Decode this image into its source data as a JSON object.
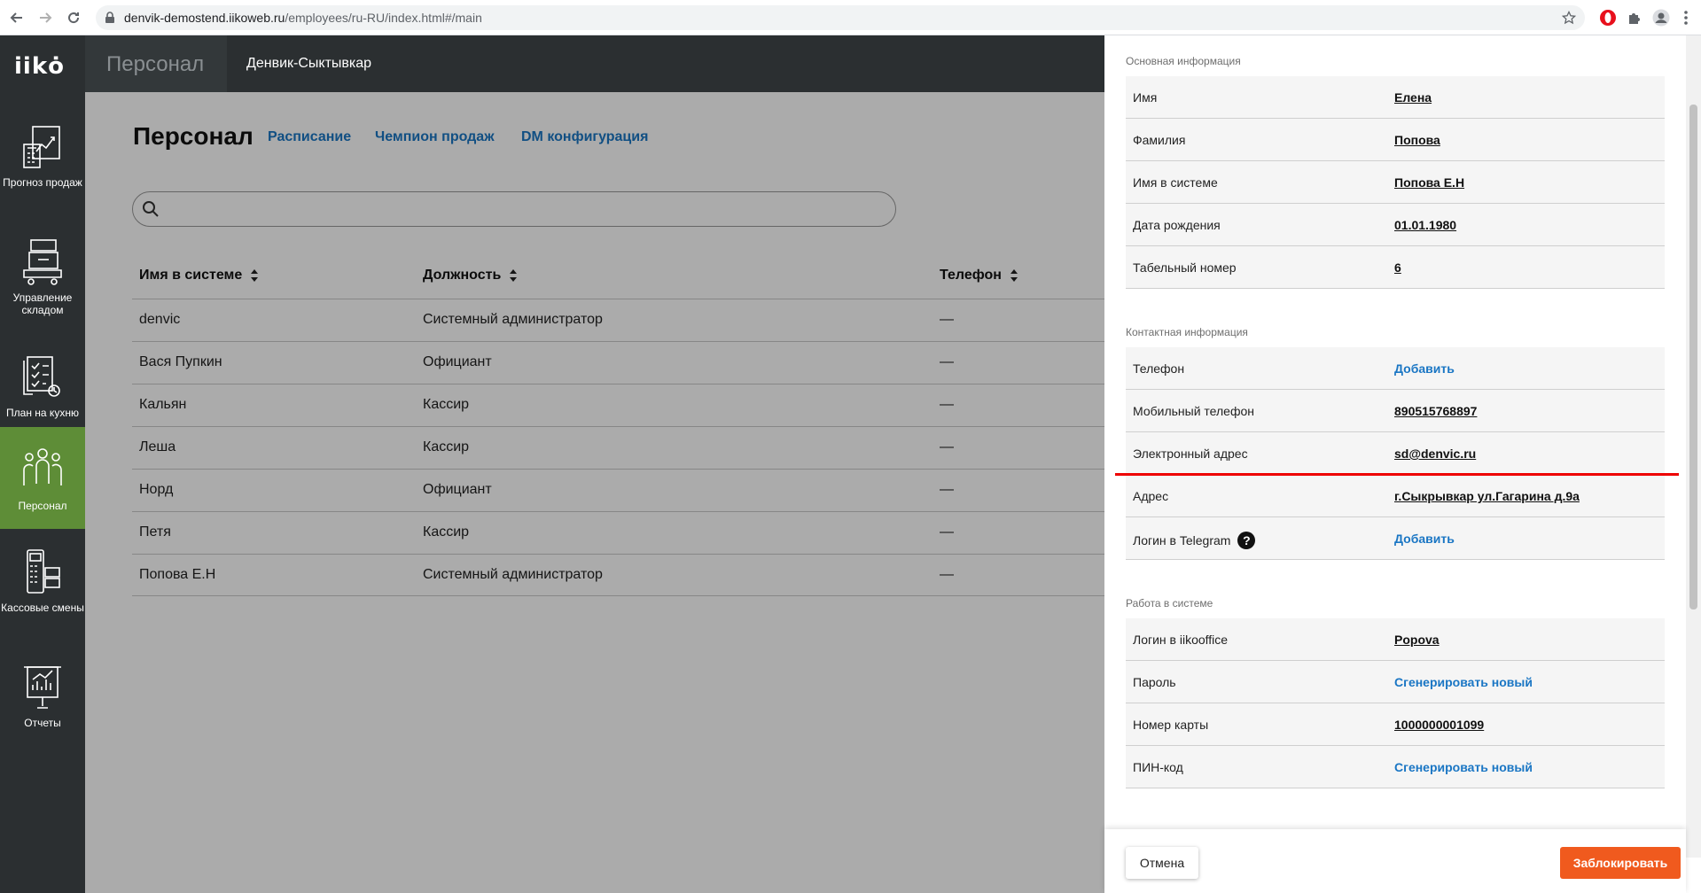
{
  "browser": {
    "url_host": "denvik-demostend.iikoweb.ru",
    "url_path": "/employees/ru-RU/index.html#/main"
  },
  "logo": "iikȯ",
  "leftnav": {
    "items": [
      {
        "label": "Прогноз продаж",
        "icon": "sales-forecast-icon"
      },
      {
        "label": "Управление складом",
        "icon": "warehouse-icon"
      },
      {
        "label": "План на кухню",
        "icon": "kitchen-plan-icon"
      },
      {
        "label": "Персонал",
        "icon": "staff-icon"
      },
      {
        "label": "Кассовые смены",
        "icon": "cash-register-icon"
      },
      {
        "label": "Отчеты",
        "icon": "reports-icon"
      }
    ]
  },
  "header": {
    "section": "Персонал",
    "org": "Денвик-Сыктывкар"
  },
  "main": {
    "title": "Персонал",
    "tabs": [
      "Расписание",
      "Чемпион продаж",
      "DM конфигурация"
    ],
    "columns": [
      "Имя в системе",
      "Должность",
      "Телефон"
    ],
    "rows": [
      {
        "name": "denvic",
        "position": "Системный администратор",
        "phone": "—"
      },
      {
        "name": "Вася Пупкин",
        "position": "Официант",
        "phone": "—"
      },
      {
        "name": "Кальян",
        "position": "Кассир",
        "phone": "—"
      },
      {
        "name": "Леша",
        "position": "Кассир",
        "phone": "—"
      },
      {
        "name": "Норд",
        "position": "Официант",
        "phone": "—"
      },
      {
        "name": "Петя",
        "position": "Кассир",
        "phone": "—"
      },
      {
        "name": "Попова Е.Н",
        "position": "Системный администратор",
        "phone": "—"
      }
    ]
  },
  "panel": {
    "basic_title": "Основная информация",
    "basic": [
      {
        "label": "Имя",
        "value": "Елена"
      },
      {
        "label": "Фамилия",
        "value": "Попова"
      },
      {
        "label": "Имя в системе",
        "value": "Попова Е.Н"
      },
      {
        "label": "Дата рождения",
        "value": "01.01.1980"
      },
      {
        "label": "Табельный номер",
        "value": "6"
      }
    ],
    "contact_title": "Контактная информация",
    "contact": [
      {
        "label": "Телефон",
        "value": "Добавить"
      },
      {
        "label": "Мобильный телефон",
        "value": "890515768897"
      },
      {
        "label": "Электронный адрес",
        "value": "sd@denvic.ru"
      },
      {
        "label": "Адрес",
        "value": "г.Сыкрывкар ул.Гагарина д.9а"
      },
      {
        "label": "Логин в Telegram",
        "value": "Добавить",
        "help": "?"
      }
    ],
    "work_title": "Работа в системе",
    "work": [
      {
        "label": "Логин в iikooffice",
        "value": "Popova"
      },
      {
        "label": "Пароль",
        "value": "Сгенерировать новый"
      },
      {
        "label": "Номер карты",
        "value": "1000000001099"
      },
      {
        "label": "ПИН-код",
        "value": "Сгенерировать новый"
      }
    ],
    "cancel_label": "Отмена",
    "block_label": "Заблокировать"
  },
  "colors": {
    "accent": "#1a76c4",
    "nav_bg": "#2b2f31",
    "nav_active": "#5e8d37",
    "block_button": "#f05a1e",
    "highlight_line": "#ee0000"
  }
}
